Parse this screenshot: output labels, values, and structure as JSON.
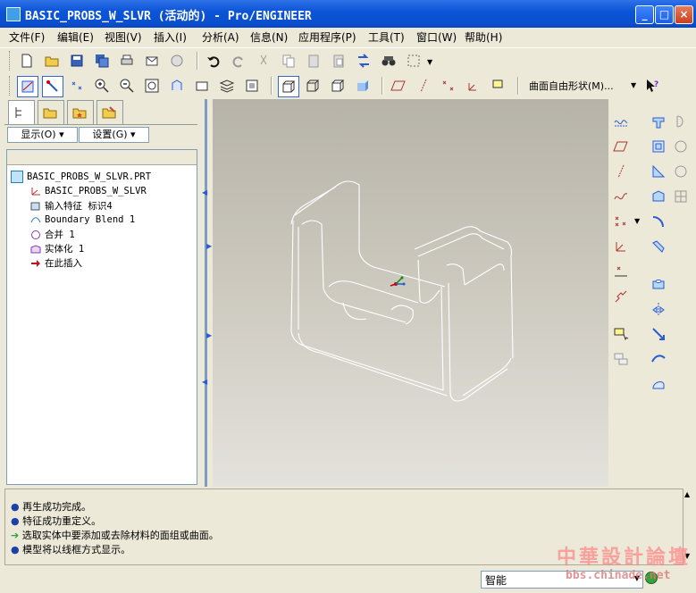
{
  "window": {
    "title": "BASIC_PROBS_W_SLVR (活动的) - Pro/ENGINEER"
  },
  "menu": [
    "文件(F)",
    "编辑(E)",
    "视图(V)",
    "插入(I)",
    "分析(A)",
    "信息(N)",
    "应用程序(P)",
    "工具(T)",
    "窗口(W)",
    "帮助(H)"
  ],
  "toolbar": {
    "freeform_label": "曲面自由形状(M)..."
  },
  "panel": {
    "show_label": "显示(O)",
    "settings_label": "设置(G)"
  },
  "tree": [
    {
      "label": "BASIC_PROBS_W_SLVR.PRT",
      "icon": "part-icon"
    },
    {
      "label": "BASIC_PROBS_W_SLVR",
      "icon": "csys-icon"
    },
    {
      "label": "输入特征 标识4",
      "icon": "import-feature-icon"
    },
    {
      "label": "Boundary Blend 1",
      "icon": "boundary-blend-icon"
    },
    {
      "label": "合并 1",
      "icon": "merge-icon"
    },
    {
      "label": "实体化 1",
      "icon": "solidify-icon"
    },
    {
      "label": "在此插入",
      "icon": "insert-here-arrow-icon"
    }
  ],
  "messages": [
    {
      "icon": "info-dot",
      "text": "再生成功完成。"
    },
    {
      "icon": "info-dot",
      "text": "特征成功重定义。"
    },
    {
      "icon": "prompt-arrow",
      "text": "选取实体中要添加或去除材料的面组或曲面。"
    },
    {
      "icon": "info-dot",
      "text": "模型将以线框方式显示。"
    }
  ],
  "status": {
    "filter_value": "智能"
  },
  "watermark": {
    "title": "中華設計論壇",
    "url": "bbs.chinade.net"
  },
  "colors": {
    "title_bar": "#0a4fce",
    "accent": "#316ac5",
    "message_dot": "#1f3fa8",
    "prompt_arrow": "#2aa13a"
  }
}
